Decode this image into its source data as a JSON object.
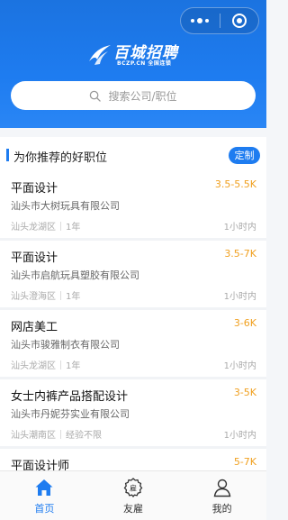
{
  "colors": {
    "primary": "#1e7cf0",
    "salary": "#f0a020"
  },
  "logo": {
    "brand": "百城招聘",
    "sub": "BCZP.CN 全国连锁"
  },
  "search": {
    "placeholder": "搜索公司/职位"
  },
  "section": {
    "title": "为你推荐的好职位",
    "customize": "定制"
  },
  "jobs": [
    {
      "title": "平面设计",
      "salary": "3.5-5.5K",
      "company": "汕头市大树玩具有限公司",
      "district": "汕头龙湖区",
      "exp": "1年",
      "time": "1小时内"
    },
    {
      "title": "平面设计",
      "salary": "3.5-7K",
      "company": "汕头市启航玩具塑胶有限公司",
      "district": "汕头澄海区",
      "exp": "1年",
      "time": "1小时内"
    },
    {
      "title": "网店美工",
      "salary": "3-6K",
      "company": "汕头市骏雅制衣有限公司",
      "district": "汕头龙湖区",
      "exp": "1年",
      "time": "1小时内"
    },
    {
      "title": "女士内裤产品搭配设计",
      "salary": "3-5K",
      "company": "汕头市丹妮芬实业有限公司",
      "district": "汕头潮南区",
      "exp": "经验不限",
      "time": "1小时内"
    },
    {
      "title": "平面设计师",
      "salary": "5-7K",
      "company": "",
      "district": "",
      "exp": "",
      "time": ""
    }
  ],
  "tabbar": {
    "home": "首页",
    "friend": "友雇",
    "mine": "我的"
  }
}
